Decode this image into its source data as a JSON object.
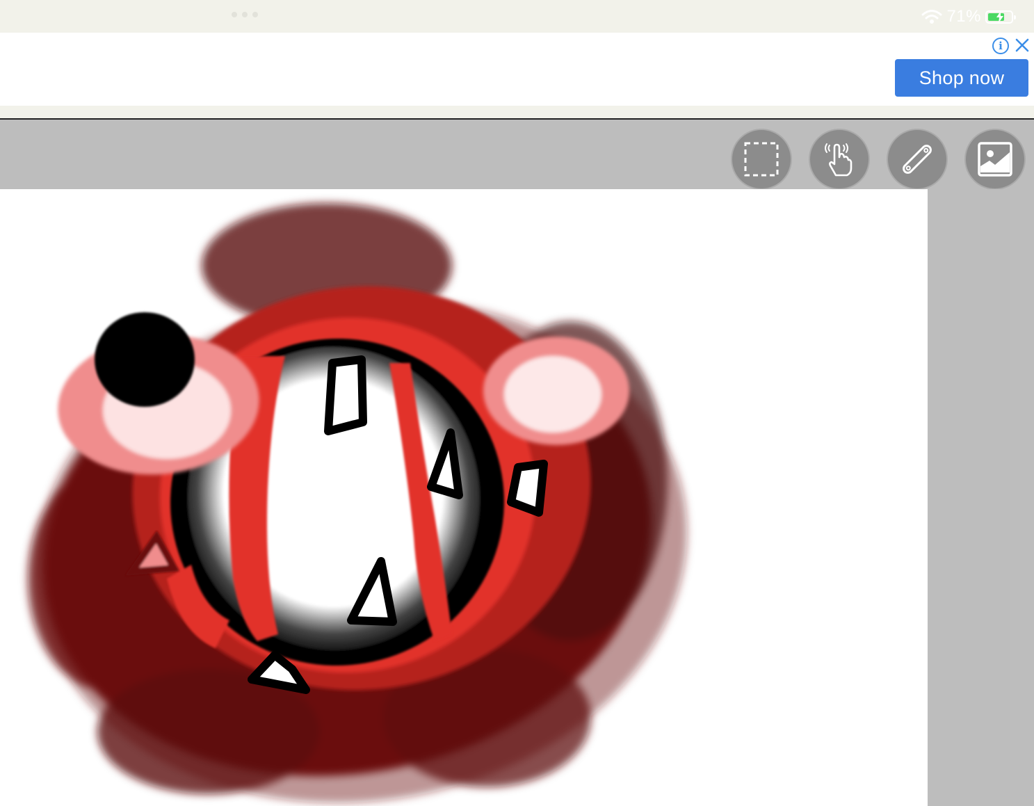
{
  "status_bar": {
    "battery_percent": "71%",
    "battery_level": 0.71,
    "charging": true,
    "wifi_icon": "wifi-icon"
  },
  "ad": {
    "button_label": "Shop now",
    "info_icon": "info-icon",
    "close_icon": "close-icon",
    "accent_color": "#3a7de0"
  },
  "toolbar": {
    "tools": [
      {
        "name": "selection-tool",
        "icon": "dashed-selection-icon"
      },
      {
        "name": "hand-tool",
        "icon": "hand-pointer-icon"
      },
      {
        "name": "ruler-tool",
        "icon": "ruler-icon"
      },
      {
        "name": "image-tool",
        "icon": "image-icon"
      }
    ]
  },
  "canvas": {
    "background_color": "#ffffff",
    "drawing_colors": [
      "#7a1010",
      "#e8312b",
      "#000000",
      "#ffffff",
      "#f4a6a6"
    ]
  }
}
